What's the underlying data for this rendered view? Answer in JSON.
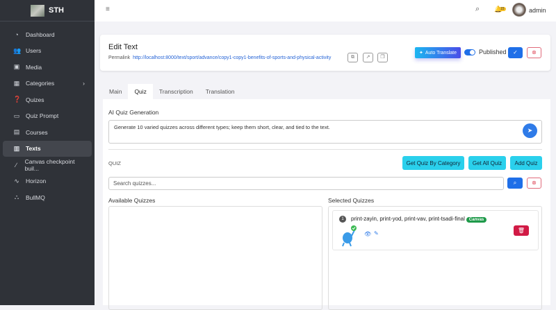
{
  "brand": {
    "name": "STH"
  },
  "sidebar": {
    "items": [
      {
        "label": "Dashboard",
        "icon": "dashboard-icon"
      },
      {
        "label": "Users",
        "icon": "users-icon"
      },
      {
        "label": "Media",
        "icon": "camera-icon"
      },
      {
        "label": "Categories",
        "icon": "grid-icon"
      },
      {
        "label": "Quizes",
        "icon": "question-icon"
      },
      {
        "label": "Quiz Prompt",
        "icon": "message-icon"
      },
      {
        "label": "Courses",
        "icon": "book-icon"
      },
      {
        "label": "Texts",
        "icon": "text-icon",
        "active": true
      },
      {
        "label": "Canvas checkpoint buil...",
        "icon": "pen-icon"
      },
      {
        "label": "Horizon",
        "icon": "pulse-icon"
      },
      {
        "label": "BullMQ",
        "icon": "sitemap-icon"
      }
    ]
  },
  "topbar": {
    "notifications": "15",
    "user": "admin"
  },
  "header": {
    "title": "Edit Text",
    "permalink_label": "Permalink",
    "permalink": "http://localhost:8000/text/sport/advance/copy1-copy1-benefits-of-sports-and-physical-activity",
    "auto_translate": "Auto Translate",
    "published": "Published",
    "published_on": true
  },
  "tabs": [
    "Main",
    "Quiz",
    "Transcription",
    "Translation"
  ],
  "quiz": {
    "ai_label": "AI Quiz Generation",
    "prompt": "Generate 10 varied quizzes across different types; keep them short, clear, and tied to the text.",
    "section": "QUIZ",
    "buttons": {
      "by_category": "Get Quiz By Category",
      "all": "Get All Quiz",
      "add": "Add Quiz"
    },
    "search_placeholder": "Search quizzes...",
    "available": "Available Quizzes",
    "selected": "Selected Quizzes",
    "selected_items": [
      {
        "num": "1",
        "title": "print-zayin, print-yod, print-vav, print-tsadi-final",
        "badge": "Canvas"
      }
    ]
  },
  "colors": {
    "primary": "#1f6fe8",
    "info": "#2ad0ec",
    "danger": "#d11a45",
    "success": "#1f9a4a",
    "sidebar": "#2f3238"
  }
}
